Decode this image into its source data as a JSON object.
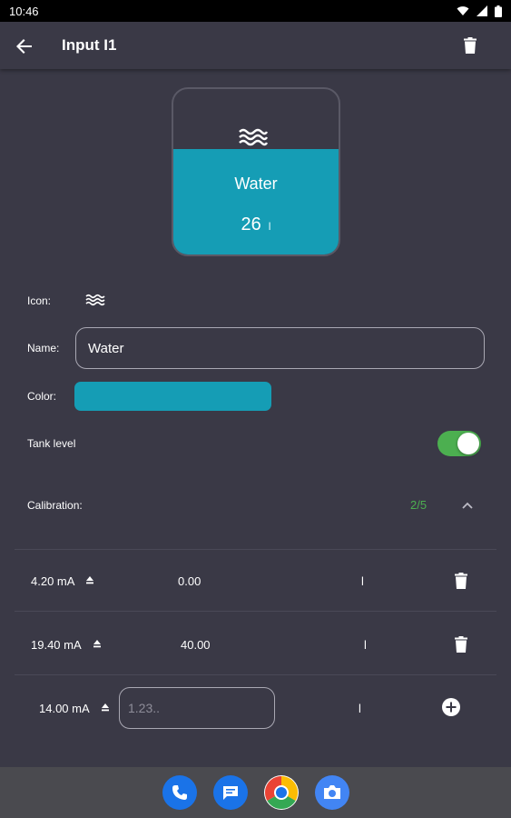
{
  "status_bar": {
    "time": "10:46"
  },
  "header": {
    "title": "Input I1"
  },
  "tank": {
    "name": "Water",
    "value": "26",
    "unit": "l",
    "icon": "water-waves-icon",
    "fill_fraction": 0.64
  },
  "form": {
    "icon_label": "Icon:",
    "name_label": "Name:",
    "name_value": "Water",
    "color_label": "Color:",
    "color": "#159db5",
    "tank_level_label": "Tank level",
    "tank_level_on": true
  },
  "calibration": {
    "label": "Calibration:",
    "count": "2/5",
    "rows": [
      {
        "ma": "4.20 mA",
        "value": "0.00",
        "unit": "l"
      },
      {
        "ma": "19.40 mA",
        "value": "40.00",
        "unit": "l"
      }
    ],
    "new_row": {
      "ma": "14.00 mA",
      "placeholder": "1.23..",
      "unit": "l"
    }
  },
  "colors": {
    "accent_green": "#4caf50",
    "background": "#3a3946",
    "tank_color": "#159db5"
  },
  "dock": [
    "phone-app-icon",
    "messages-app-icon",
    "chrome-app-icon",
    "camera-app-icon"
  ]
}
